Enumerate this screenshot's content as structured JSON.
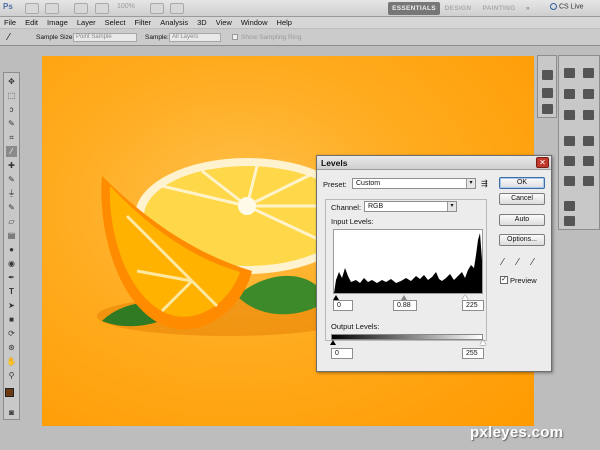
{
  "appbar": {
    "logo": "Ps",
    "zoom": "100%",
    "workspaces": [
      "ESSENTIALS",
      "DESIGN",
      "PAINTING",
      "»"
    ],
    "cs_live": "CS Live"
  },
  "menu": [
    "File",
    "Edit",
    "Image",
    "Layer",
    "Select",
    "Filter",
    "Analysis",
    "3D",
    "View",
    "Window",
    "Help"
  ],
  "options_bar": {
    "sample_size_label": "Sample Size:",
    "sample_size_value": "Point Sample",
    "sample_label": "Sample:",
    "sample_value": "All Layers",
    "show_ring_label": "Show Sampling Ring"
  },
  "levels_dialog": {
    "title": "Levels",
    "preset_label": "Preset:",
    "preset_value": "Custom",
    "channel_label": "Channel:",
    "channel_value": "RGB",
    "input_levels_label": "Input Levels:",
    "input_black": "0",
    "input_gamma": "0.88",
    "input_white": "225",
    "output_levels_label": "Output Levels:",
    "output_black": "0",
    "output_white": "255",
    "buttons": {
      "ok": "OK",
      "cancel": "Cancel",
      "auto": "Auto",
      "options": "Options..."
    },
    "preview_label": "Preview",
    "preview_checked": true
  },
  "watermark": "pxleyes.com",
  "colors": {
    "canvas_orange": "#ffab1e",
    "ok_blue": "#3b6ea8",
    "close_red": "#c0392b",
    "foreground": "#6b3a12"
  }
}
